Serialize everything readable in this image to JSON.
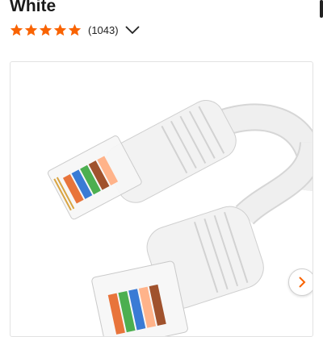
{
  "product": {
    "title": "White",
    "rating": 5,
    "rating_max": 5,
    "review_count": "(1043)"
  },
  "icons": {
    "star": "star-icon",
    "expand": "chevron-down-icon",
    "next": "chevron-right-icon"
  },
  "colors": {
    "star": "#f96302",
    "next_arrow": "#f96302",
    "cable": "#efefef"
  }
}
